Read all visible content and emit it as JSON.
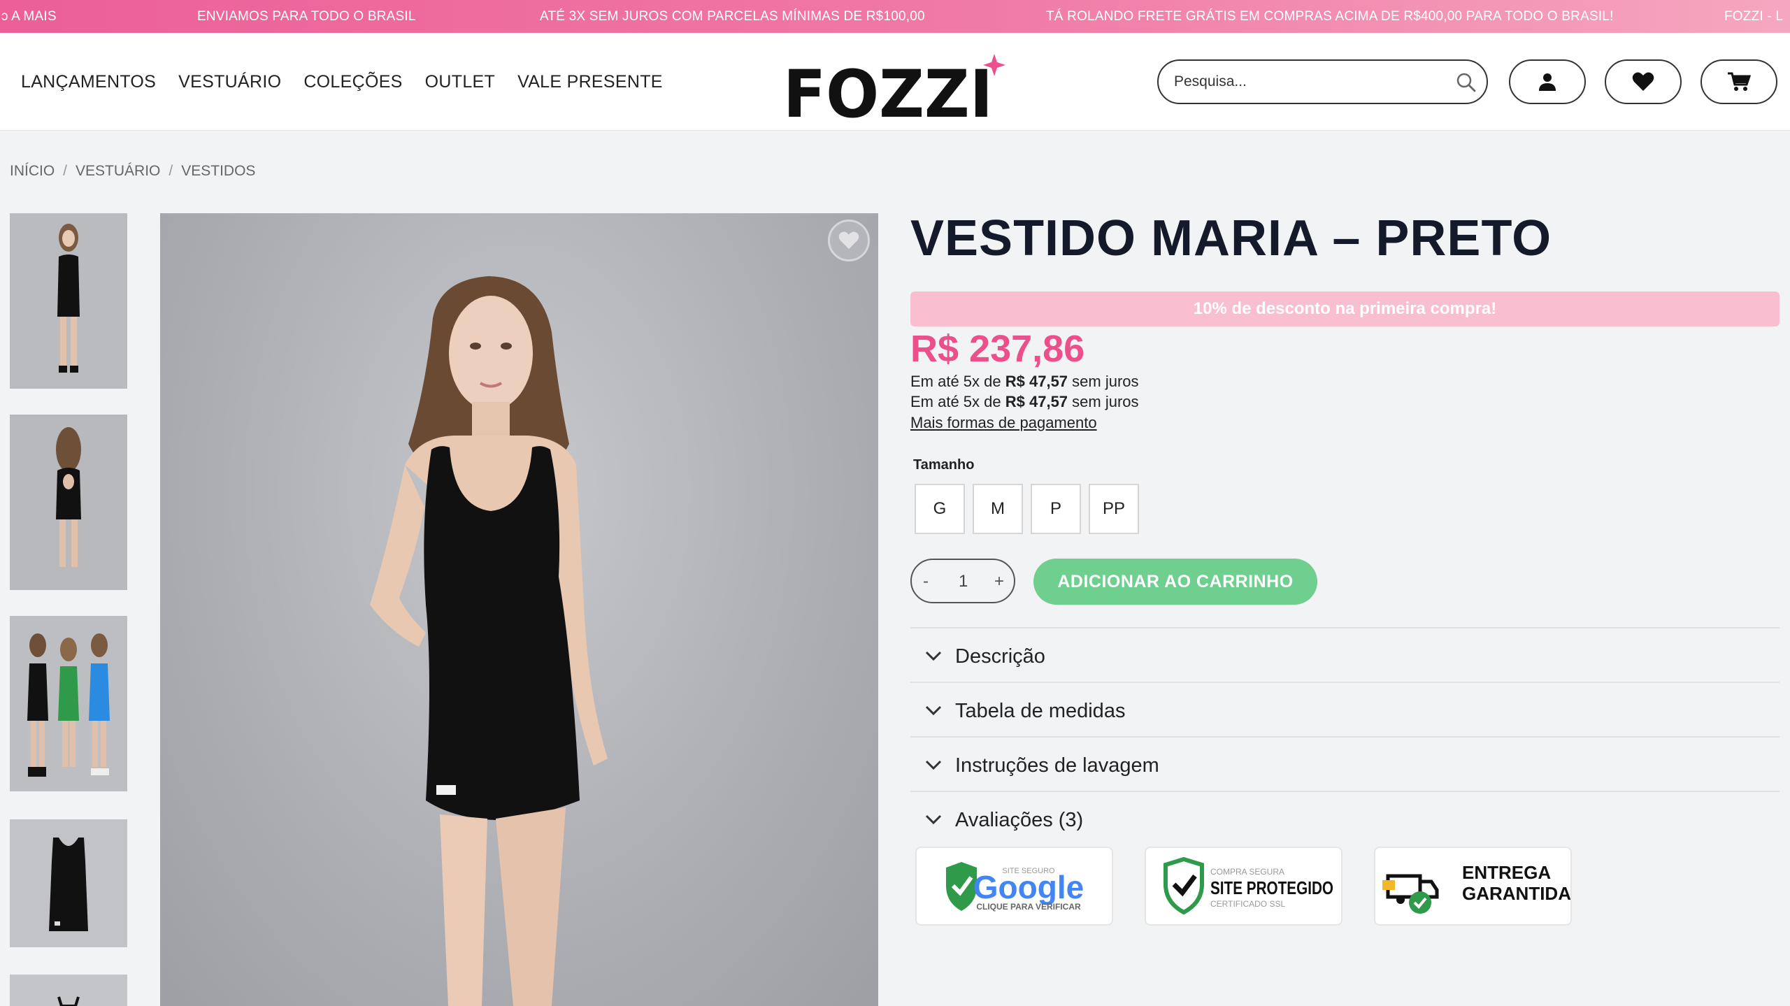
{
  "announcement": {
    "items": [
      "ↄ A MAIS",
      "ENVIAMOS PARA TODO O BRASIL",
      "ATÉ 3X SEM JUROS COM PARCELAS MÍNIMAS DE R$100,00",
      "TÁ ROLANDO FRETE GRÁTIS EM COMPRAS ACIMA DE R$400,00 PARA TODO O BRASIL!",
      "FOZZI - L"
    ]
  },
  "header": {
    "nav": [
      "LANÇAMENTOS",
      "VESTUÁRIO",
      "COLEÇÕES",
      "OUTLET",
      "VALE PRESENTE"
    ],
    "logo_text": "FOZZI",
    "search_placeholder": "Pesquisa..."
  },
  "breadcrumb": [
    "INÍCIO",
    "VESTUÁRIO",
    "VESTIDOS"
  ],
  "product": {
    "title": "VESTIDO MARIA – PRETO",
    "promo": "10% de desconto na primeira compra!",
    "price": "R$ 237,86",
    "installment_prefix": "Em até 5x de ",
    "installment_value": "R$ 47,57",
    "installment_suffix": " sem juros",
    "more_payment": "Mais formas de pagamento",
    "size_label": "Tamanho",
    "sizes": [
      "G",
      "M",
      "P",
      "PP"
    ],
    "qty_minus": "-",
    "qty_value": "1",
    "qty_plus": "+",
    "add_to_cart": "ADICIONAR AO CARRINHO",
    "dress_tag": "FOZZI"
  },
  "accordion": [
    "Descrição",
    "Tabela de medidas",
    "Instruções de lavagem",
    "Avaliações (3)"
  ],
  "badges": {
    "google": {
      "top": "SITE SEGURO",
      "brand": "Google",
      "bottom": "CLIQUE PARA VERIFICAR"
    },
    "ssl": {
      "top": "COMPRA SEGURA",
      "main": "SITE PROTEGIDO",
      "bottom": "CERTIFICADO SSL"
    },
    "delivery": {
      "line1": "ENTREGA",
      "line2": "GARANTIDA"
    }
  },
  "colors": {
    "accent": "#ec4f8c",
    "cart_button": "#6fcf8f",
    "promo": "#f9bfd0",
    "title": "#151a2b"
  }
}
